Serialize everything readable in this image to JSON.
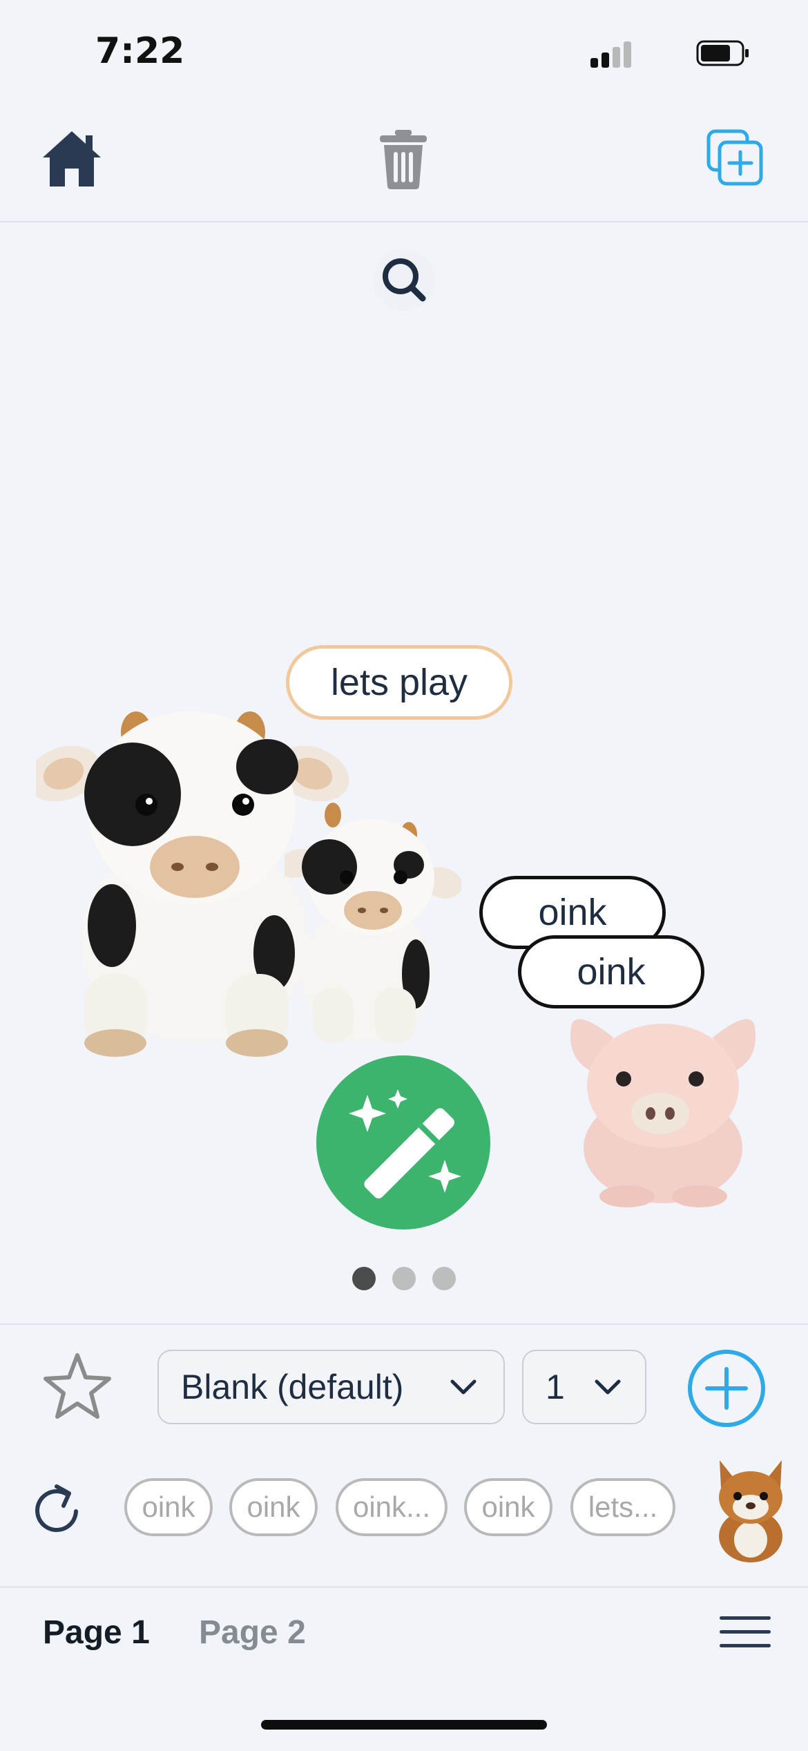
{
  "status_bar": {
    "time": "7:22"
  },
  "toolbar": {
    "home_icon": "home-icon",
    "delete_icon": "trash-icon",
    "duplicate_icon": "duplicate-plus-icon"
  },
  "canvas": {
    "search_icon": "search-icon",
    "bubbles": [
      {
        "text": "lets play"
      },
      {
        "text": "oink"
      },
      {
        "text": "oink"
      }
    ],
    "magic_icon": "magic-wand-icon",
    "page_indicator": {
      "count": 3,
      "active": 1
    }
  },
  "controls": {
    "template_select": "Blank (default)",
    "count_select": "1",
    "chips": [
      "oink",
      "oink",
      "oink...",
      "oink",
      "lets..."
    ]
  },
  "footer": {
    "tabs": [
      "Page 1",
      "Page 2"
    ],
    "active_tab": "Page 1"
  },
  "colors": {
    "accent_blue": "#2fa9e8",
    "magic_green": "#3cb46e",
    "navy": "#2a3a52",
    "bubble_orange": "#f2c89b"
  }
}
